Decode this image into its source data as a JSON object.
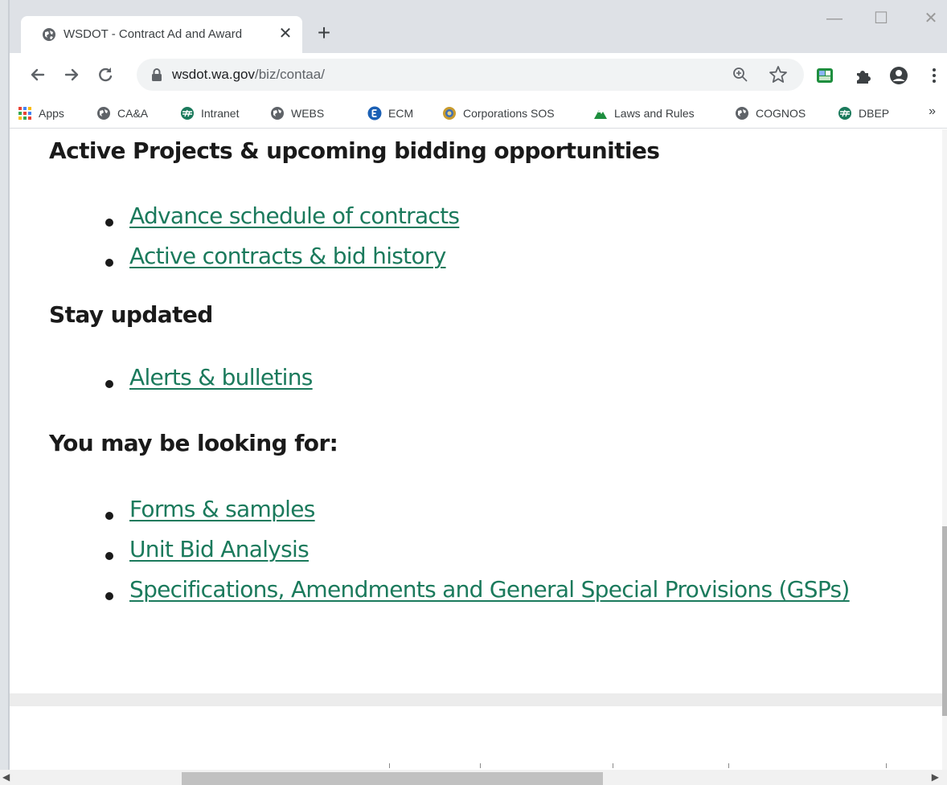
{
  "browser": {
    "tab_title": "WSDOT - Contract Ad and Award",
    "tab_close": "✕",
    "new_tab": "+",
    "window_controls": {
      "minimize": "—",
      "maximize": "☐",
      "close": "✕"
    },
    "url_host": "wsdot.wa.gov",
    "url_path": "/biz/contaa/",
    "bookmarks": [
      {
        "label": "Apps",
        "icon": "apps-grid-icon"
      },
      {
        "label": "CA&A",
        "icon": "globe-icon"
      },
      {
        "label": "Intranet",
        "icon": "wsdot-logo-icon"
      },
      {
        "label": "WEBS",
        "icon": "globe-icon"
      },
      {
        "label": "ECM",
        "icon": "ecm-e-icon"
      },
      {
        "label": "Corporations SOS",
        "icon": "seal-icon"
      },
      {
        "label": "Laws and Rules",
        "icon": "mountain-icon"
      },
      {
        "label": "COGNOS",
        "icon": "globe-icon"
      },
      {
        "label": "DBEP",
        "icon": "wsdot-logo-icon"
      }
    ],
    "bookmarks_more": "»"
  },
  "content": {
    "sections": [
      {
        "heading": "Active Projects & upcoming bidding opportunities",
        "links": [
          "Advance schedule of contracts",
          "Active contracts & bid history"
        ]
      },
      {
        "heading": "Stay updated",
        "links": [
          "Alerts & bulletins"
        ]
      },
      {
        "heading": "You may be looking for:",
        "links": [
          "Forms & samples",
          "Unit Bid Analysis",
          "Specifications, Amendments and General Special Provisions (GSPs)"
        ]
      }
    ]
  },
  "colors": {
    "link": "#1b7a5c",
    "heading": "#1a1a1a",
    "tabstrip": "#dee1e6",
    "omnibox": "#f1f3f4"
  }
}
